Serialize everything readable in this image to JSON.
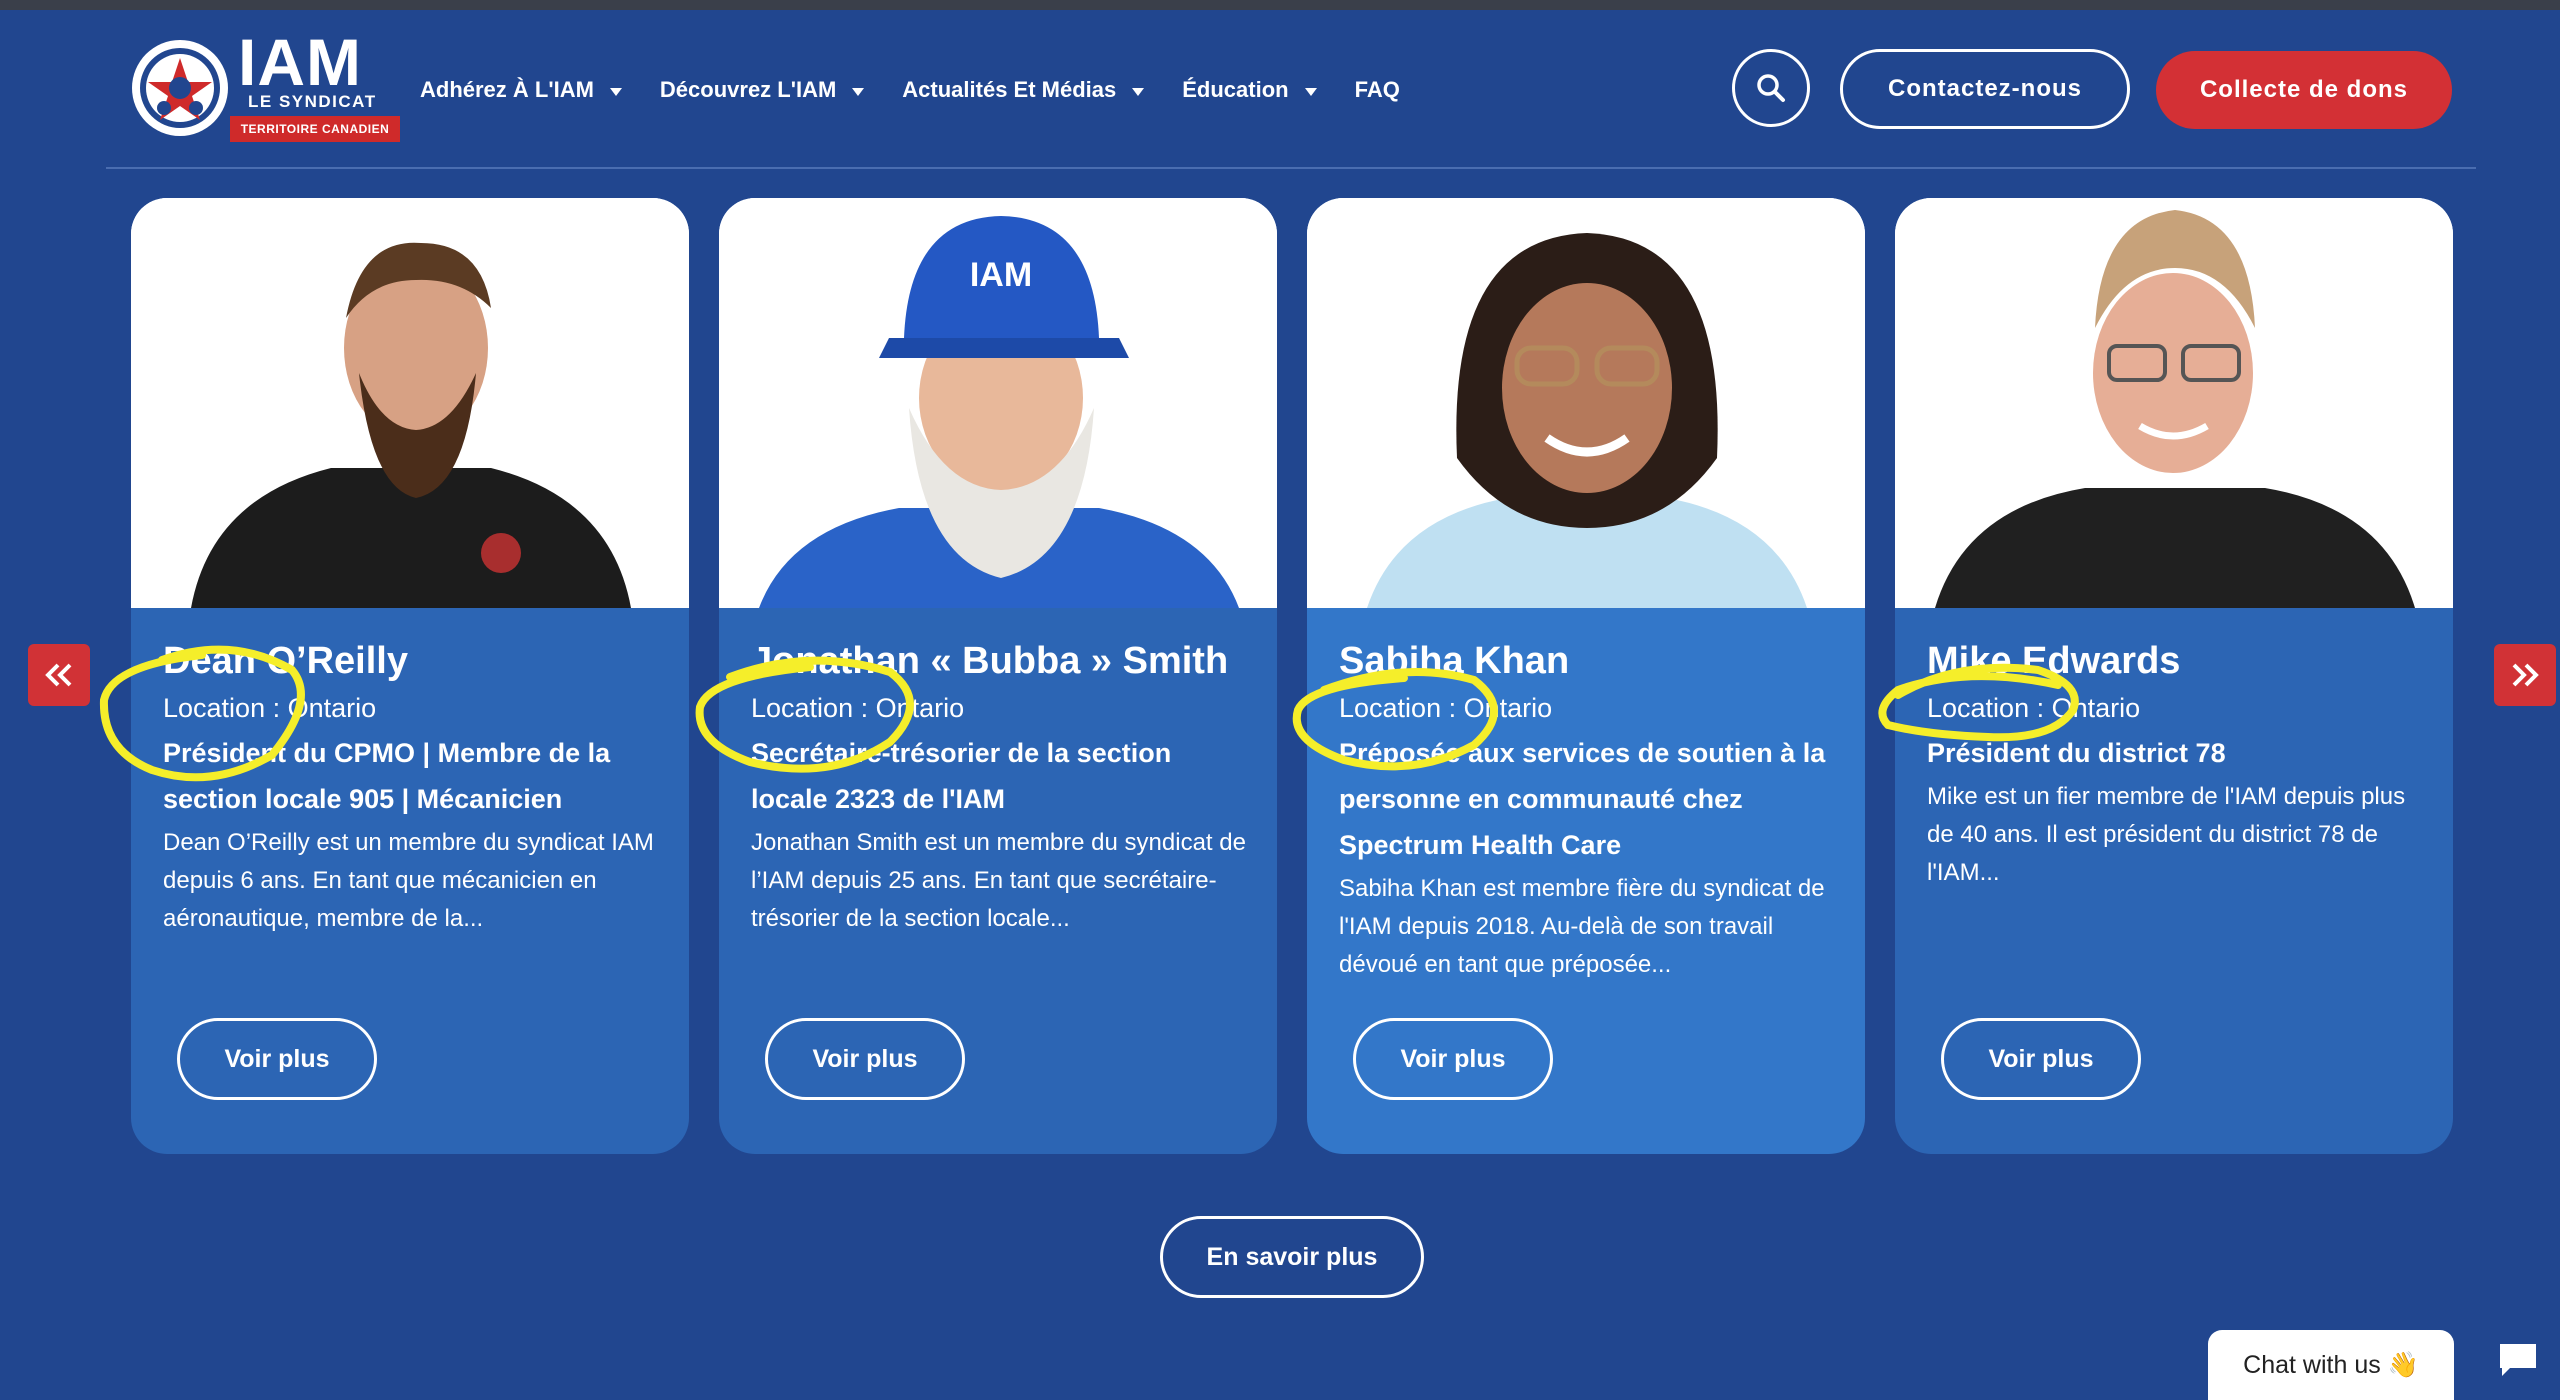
{
  "header": {
    "logo": {
      "title": "IAM",
      "subtitle": "LE SYNDICAT",
      "badge": "TERRITOIRE CANADIEN"
    },
    "nav": [
      {
        "label": "Adhérez À L'IAM",
        "has_dropdown": true
      },
      {
        "label": "Découvrez L'IAM",
        "has_dropdown": true
      },
      {
        "label": "Actualités Et Médias",
        "has_dropdown": true
      },
      {
        "label": "Éducation",
        "has_dropdown": true
      },
      {
        "label": "FAQ",
        "has_dropdown": false
      }
    ],
    "search_icon": "search-icon",
    "contact_label": "Contactez-nous",
    "donate_label": "Collecte de dons"
  },
  "carousel": {
    "prev_icon": "double-chevron-left-icon",
    "next_icon": "double-chevron-right-icon",
    "cards": [
      {
        "name": "Dean O’Reilly",
        "location": "Location : Ontario",
        "role": "Président du CPMO | Membre de la section locale 905 | Mécanicien",
        "description": "Dean O’Reilly est un membre du syndicat IAM depuis 6 ans. En tant que mécanicien en aéronautique, membre de la...",
        "button": "Voir plus"
      },
      {
        "name": "Jonathan « Bubba » Smith",
        "location": "Location : Ontario",
        "role": "Secrétaire-trésorier de la section locale 2323 de l'IAM",
        "description": "Jonathan Smith est un membre du syndicat de l’IAM depuis 25 ans. En tant que secrétaire-trésorier de la section locale...",
        "button": "Voir plus"
      },
      {
        "name": "Sabiha Khan",
        "location": "Location : Ontario",
        "role": "Préposée aux services de soutien à la personne en communauté chez Spectrum Health Care",
        "description": "Sabiha Khan est membre fière du syndicat de l'IAM depuis 2018. Au-delà de son travail dévoué en tant que préposée...",
        "button": "Voir plus"
      },
      {
        "name": "Mike Edwards",
        "location": "Location : Ontario",
        "role": "Président du district 78",
        "description": "Mike est un fier membre de l'IAM depuis plus de 40 ans. Il est président du district 78 de l'IAM...",
        "button": "Voir plus"
      }
    ]
  },
  "more_label": "En savoir plus",
  "chat": {
    "label": "Chat with us 👋",
    "icon": "chat-bubble-icon"
  },
  "colors": {
    "background": "#21468f",
    "card": "#2c65b4",
    "card_active": "#3377c9",
    "accent_red": "#d33035",
    "highlight_yellow": "#f5ee2a"
  }
}
